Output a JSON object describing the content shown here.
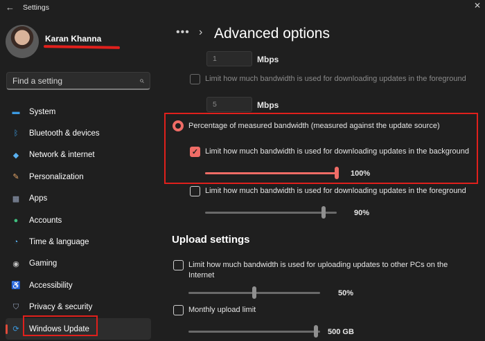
{
  "window": {
    "title": "Settings",
    "back_icon": "back-arrow-icon",
    "close_icon": "close-icon"
  },
  "user": {
    "name": "Karan Khanna"
  },
  "search": {
    "placeholder": "Find a setting"
  },
  "nav": [
    {
      "label": "System",
      "icon": "monitor-icon",
      "color": "#3b9ae1"
    },
    {
      "label": "Bluetooth & devices",
      "icon": "bluetooth-icon",
      "color": "#3b9ae1"
    },
    {
      "label": "Network & internet",
      "icon": "wifi-icon",
      "color": "#5ab0f0"
    },
    {
      "label": "Personalization",
      "icon": "brush-icon",
      "color": "#e8a86a"
    },
    {
      "label": "Apps",
      "icon": "apps-icon",
      "color": "#9aa7c0"
    },
    {
      "label": "Accounts",
      "icon": "person-icon",
      "color": "#3fbf7f"
    },
    {
      "label": "Time & language",
      "icon": "globe-clock-icon",
      "color": "#5ab0f0"
    },
    {
      "label": "Gaming",
      "icon": "gamepad-icon",
      "color": "#c0c0c0"
    },
    {
      "label": "Accessibility",
      "icon": "accessibility-icon",
      "color": "#3b9ae1"
    },
    {
      "label": "Privacy & security",
      "icon": "shield-icon",
      "color": "#9aa7c0"
    },
    {
      "label": "Windows Update",
      "icon": "update-icon",
      "color": "#3b9ae1",
      "active": true
    }
  ],
  "breadcrumb": {
    "more": "•••",
    "separator": "›",
    "title": "Advanced options"
  },
  "download": {
    "absolute_fg_value": "1",
    "absolute_fg_unit": "Mbps",
    "absolute_fg_limit_label": "Limit how much bandwidth is used for downloading updates in the foreground",
    "absolute_bg_value": "5",
    "absolute_bg_unit": "Mbps",
    "percentage_option_label": "Percentage of measured bandwidth (measured against the update source)",
    "bg_limit_label": "Limit how much bandwidth is used for downloading updates in the background",
    "bg_percent_label": "100%",
    "bg_percent": 100,
    "fg_limit_label": "Limit how much bandwidth is used for downloading updates in the foreground",
    "fg_percent_label": "90%",
    "fg_percent": 90
  },
  "upload": {
    "title": "Upload settings",
    "limit_line1": "Limit how much bandwidth is used for uploading updates to other PCs on the",
    "limit_line2": "Internet",
    "limit_percent_label": "50%",
    "limit_percent": 50,
    "monthly_label": "Monthly upload limit",
    "monthly_value_label": "500 GB",
    "monthly_fraction": 0.97
  },
  "colors": {
    "accent": "#ef6c66",
    "highlight_box": "#e0201c",
    "background": "#1f1f1f"
  }
}
